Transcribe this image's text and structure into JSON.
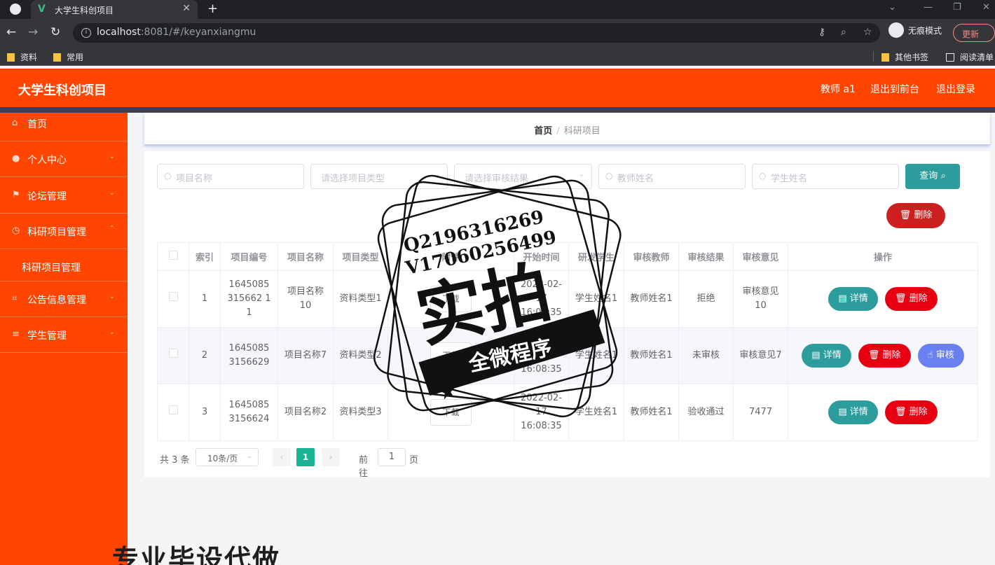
{
  "browser": {
    "tab_title": "大学生科创项目",
    "url_host": "localhost",
    "url_rest": ":8081/#/keyanxiangmu",
    "incognito_label": "无痕模式",
    "update_label": "更新",
    "bookmarks": [
      "资料",
      "常用"
    ],
    "bookmarks_right": [
      "其他书签",
      "阅读清单"
    ]
  },
  "header": {
    "title": "大学生科创项目",
    "user": "教师 a1",
    "to_front": "退出到前台",
    "logout": "退出登录"
  },
  "sidebar": {
    "items": [
      {
        "label": "首页",
        "icon": "home-icon"
      },
      {
        "label": "个人中心",
        "icon": "user-icon"
      },
      {
        "label": "论坛管理",
        "icon": "flag-icon"
      },
      {
        "label": "科研项目管理",
        "icon": "clock-icon"
      },
      {
        "label": "公告信息管理",
        "icon": "crop-icon"
      },
      {
        "label": "学生管理",
        "icon": "list-icon"
      }
    ],
    "submenu_label": "科研项目管理"
  },
  "breadcrumb": {
    "home": "首页",
    "sep": "/",
    "current": "科研项目"
  },
  "search": {
    "project_name_placeholder": "项目名称",
    "type_placeholder": "请选择项目类型",
    "result_placeholder": "请选择审核结果",
    "teacher_placeholder": "教师姓名",
    "student_placeholder": "学生姓名",
    "query_label": "查询",
    "delete_label": "删除"
  },
  "table": {
    "headers": [
      "",
      "索引",
      "项目编号",
      "项目名称",
      "项目类型",
      "附件",
      "开始时间",
      "研发学生",
      "审核教师",
      "审核结果",
      "审核意见",
      "操作"
    ],
    "rows": [
      {
        "index": "1",
        "code": "1645085315662 11",
        "name": "项目名称10",
        "type": "资料类型1",
        "attach": "下载",
        "start": "2022-02-17 16:08:35",
        "student": "学生姓名1",
        "teacher": "教师姓名1",
        "result": "拒绝",
        "opinion": "审核意见10",
        "audit": false
      },
      {
        "index": "2",
        "code": "16450853156629",
        "name": "项目名称7",
        "type": "资料类型2",
        "attach": "下载",
        "start": "2022-02-17 16:08:35",
        "student": "学生姓名1",
        "teacher": "教师姓名1",
        "result": "未审核",
        "opinion": "审核意见7",
        "audit": true
      },
      {
        "index": "3",
        "code": "16450853156624",
        "name": "项目名称2",
        "type": "资料类型3",
        "attach": "下载",
        "start": "2022-02-17 16:08:35",
        "student": "学生姓名1",
        "teacher": "教师姓名1",
        "result": "验收通过",
        "opinion": "7477",
        "audit": false
      }
    ],
    "detail_label": "详情",
    "delete_label": "删除",
    "audit_label": "审核"
  },
  "pager": {
    "total": "共 3 条",
    "page_size": "10条/页",
    "current": "1",
    "goto_label": "前往",
    "goto_value": "1",
    "page_label": "页"
  },
  "watermark": {
    "line1": "Q2196316269",
    "line2": "V17060256499",
    "big": "实拍",
    "banner": "全微程序",
    "bottom": "专业毕设代做"
  },
  "colors": {
    "accent": "#ff4500",
    "teal": "#2c9c9c",
    "red": "#e60012",
    "indigo": "#6b80f0",
    "pager_active": "#1ab394"
  }
}
